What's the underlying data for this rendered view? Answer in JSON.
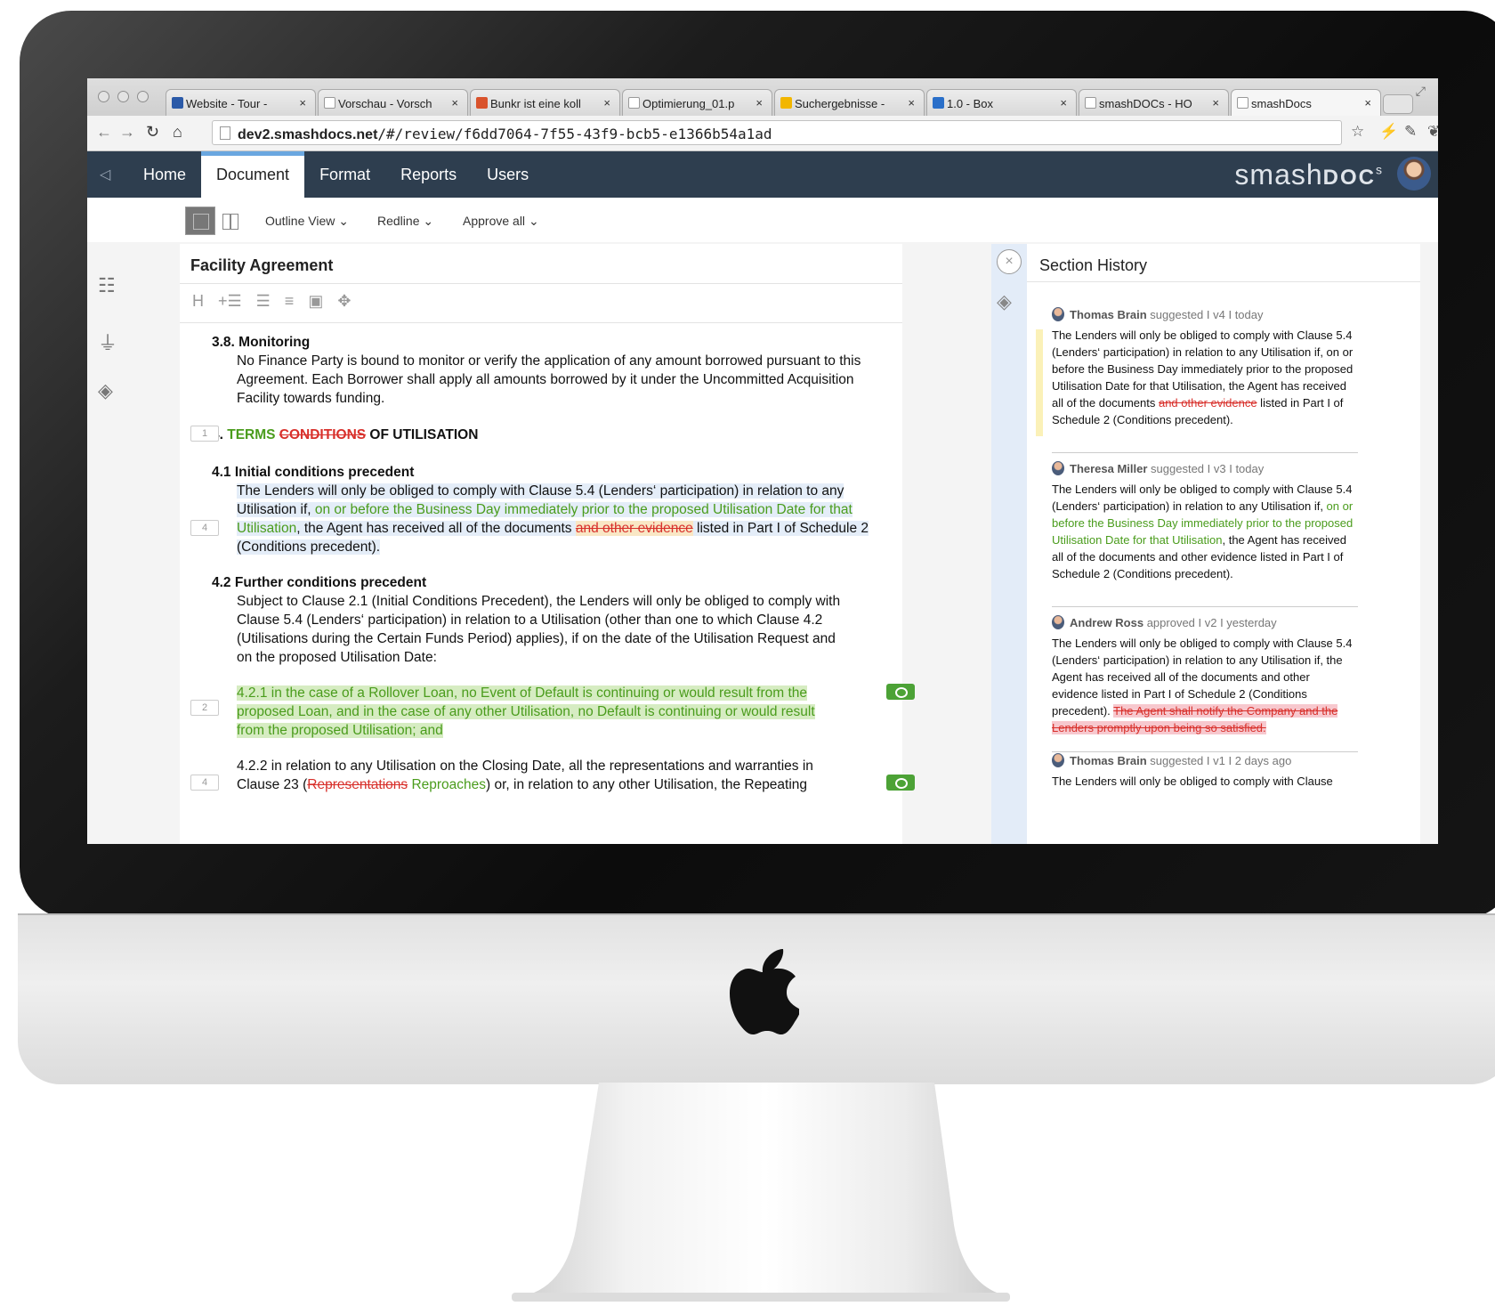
{
  "browser": {
    "tabs": [
      {
        "title": "Website - Tour - ",
        "icon": "a-favicon",
        "active": false
      },
      {
        "title": "Vorschau - Vorsch",
        "icon": "page-favicon",
        "active": false
      },
      {
        "title": "Bunkr ist eine koll",
        "icon": "bunkr-favicon",
        "active": false
      },
      {
        "title": "Optimierung_01.p",
        "icon": "page-favicon",
        "active": false
      },
      {
        "title": "Suchergebnisse - ",
        "icon": "drive-favicon",
        "active": false
      },
      {
        "title": "1.0 - Box",
        "icon": "box-favicon",
        "active": false
      },
      {
        "title": "smashDOCs - HO",
        "icon": "page-favicon",
        "active": false
      },
      {
        "title": "smashDocs",
        "icon": "page-favicon",
        "active": true
      }
    ],
    "tab_close": "×",
    "url_host": "dev2.smashdocs.net",
    "url_path": "/#/review/f6dd7064-7f55-43f9-bcb5-e1366b54a1ad"
  },
  "app": {
    "menu": [
      "Home",
      "Document",
      "Format",
      "Reports",
      "Users"
    ],
    "active_menu": "Document",
    "brand_light": "smash",
    "brand_bold": "DOC",
    "brand_sup": "s"
  },
  "toolbar": {
    "outline_view": "Outline View",
    "redline": "Redline",
    "approve_all": "Approve all"
  },
  "document": {
    "title": "Facility Agreement",
    "s38_heading": "3.8. Monitoring",
    "s38_body": "No Finance Party is bound to monitor or verify the application of any amount borrowed pursuant to this Agreement. Each Borrower shall apply all amounts borrowed by it under the Uncommitted Acquisition Facility towards funding.",
    "s4_marker": "1",
    "s4_number": "4. ",
    "s4_inserted": "TERMS",
    "s4_deleted": "CONDITIONS",
    "s4_rest": " OF UTILISATION",
    "s41_heading": "4.1 Initial conditions precedent",
    "s41_marker": "4",
    "s41_a": "The Lenders will only be obliged to comply with Clause 5.4 (Lenders‘ participation) in relation to any Utilisation if, ",
    "s41_inserted": "on or before the Business Day immediately prior to the proposed Utilisation Date for that Utilisation",
    "s41_b": ", the Agent has received all of the documents ",
    "s41_deleted": "and other evidence",
    "s41_c": " listed in Part I of Schedule 2 (Conditions precedent).",
    "s42_heading": "4.2 Further conditions precedent",
    "s42_body": "Subject to Clause 2.1 (Initial Conditions Precedent), the Lenders will only be obliged to comply with Clause 5.4 (Lenders‘ participation) in relation to a Utilisation (other than one to which Clause 4.2 (Utilisations during the Certain Funds Period) applies), if on the date of the Utilisation Request and on the proposed Utilisation Date:",
    "s421_marker": "2",
    "s421_body": "4.2.1 in the case of a Rollover Loan, no Event of Default is continuing or would result from the proposed Loan, and in the case of any other Utilisation, no Default is continuing or would result from the proposed Utilisation; and",
    "s422_marker": "4",
    "s422_a": "4.2.2 in relation to any Utilisation on the Closing Date, all the representations and warranties in Clause 23 (",
    "s422_deleted": "Representations",
    "s422_inserted": " Reproaches",
    "s422_b": ") or, in relation to any other Utilisation, the Repeating"
  },
  "history": {
    "title": "Section History",
    "entries": [
      {
        "author": "Thomas Brain",
        "meta": " suggested I v4 I today",
        "text_a": "The Lenders will only be obliged to comply with Clause 5.4 (Lenders‘ participation) in relation to any Utilisation if, on or before the Business Day immediately prior to the proposed Utilisation Date for that Utilisation, the Agent has received all of the documents ",
        "text_deleted": "and other evidence",
        "text_b": " listed in Part I of Schedule 2 (Conditions precedent)."
      },
      {
        "author": "Theresa Miller",
        "meta": " suggested I v3 I today",
        "text_a": "The Lenders will only be obliged to comply with Clause 5.4 (Lenders‘ participation) in relation to any Utilisation if, ",
        "text_inserted": "on or before the Business Day immediately prior to the proposed Utilisation Date for that Utilisation",
        "text_b": ", the Agent has received all of the documents and other evidence listed in Part I of Schedule 2 (Conditions precedent)."
      },
      {
        "author": "Andrew Ross",
        "meta": " approved I v2 I yesterday",
        "text_a": "The Lenders will only be obliged to comply with Clause 5.4 (Lenders‘ participation) in relation to any Utilisation if, the Agent has received all of the documents and other evidence listed in Part I of Schedule 2 (Conditions precedent). ",
        "text_deleted": "The Agent shall notify the Company and the Lenders promptly upon being so satisfied."
      },
      {
        "author": "Thomas Brain",
        "meta": " suggested I v1 I 2 days ago",
        "text_a": "The Lenders will only be obliged to comply with Clause"
      }
    ]
  },
  "colors": {
    "appbar": "#2e3e4f",
    "inserted": "#4a9c1c",
    "deleted": "#d8302b",
    "approve_eye": "#4ca236"
  }
}
